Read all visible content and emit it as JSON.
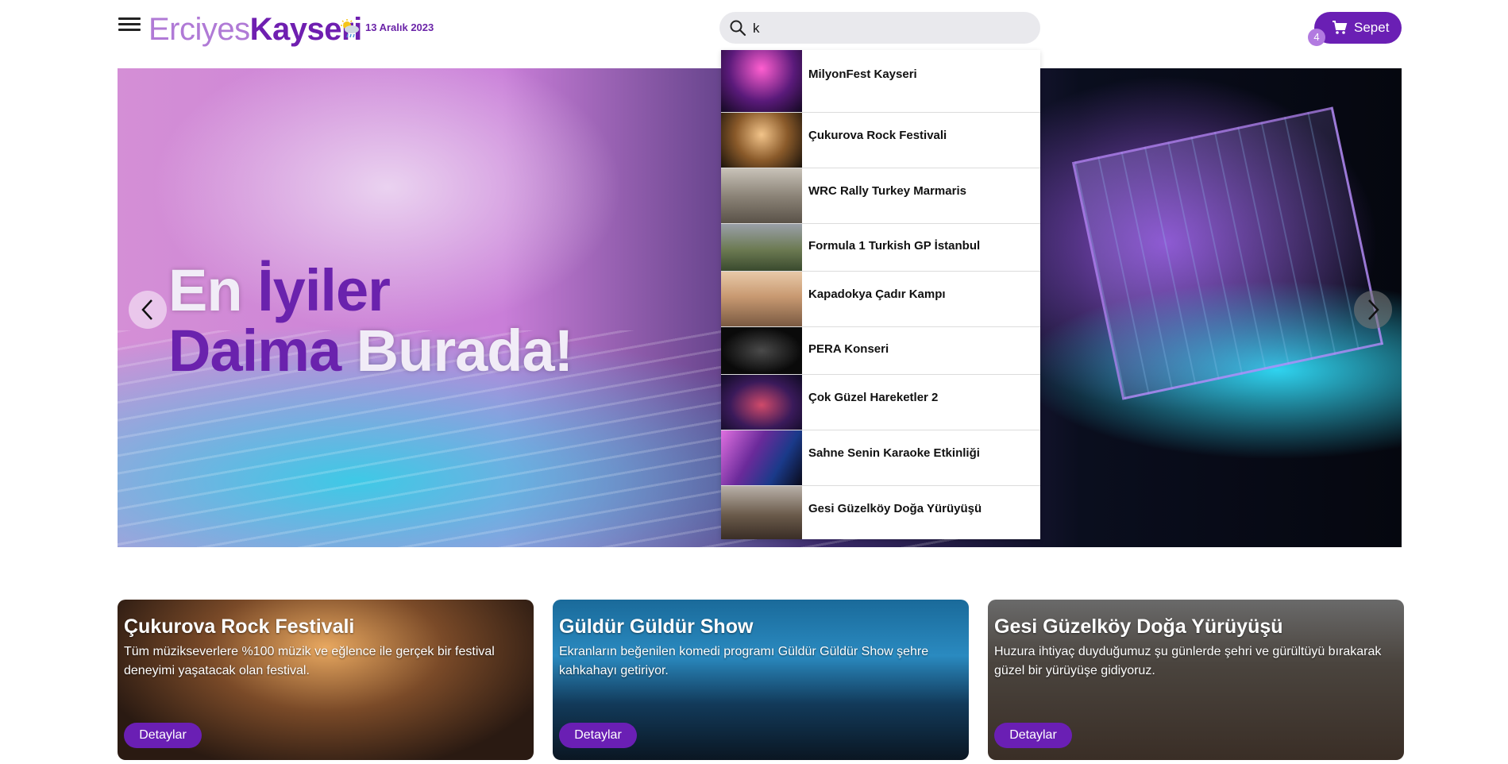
{
  "header": {
    "menu_icon": "hamburger-menu-icon",
    "logo_part1": "Erciyes",
    "logo_part2": "Kayseri",
    "weather_icon": "sun-cloud-rain-icon",
    "date": "13 Aralık 2023",
    "search": {
      "value": "k",
      "placeholder": ""
    },
    "cart": {
      "label": "Sepet",
      "count": "4"
    }
  },
  "colors": {
    "brand": "#6a1fb4",
    "brand_light": "#b07ad6"
  },
  "hero": {
    "line1_a": "En ",
    "line1_b": "İyiler",
    "line2_a": "Daima ",
    "line2_b": "Burada!"
  },
  "search_results": [
    {
      "label": "MilyonFest Kayseri"
    },
    {
      "label": "Çukurova Rock Festivali"
    },
    {
      "label": "WRC Rally Turkey Marmaris"
    },
    {
      "label": "Formula 1 Turkish GP İstanbul"
    },
    {
      "label": "Kapadokya Çadır Kampı"
    },
    {
      "label": "PERA Konseri"
    },
    {
      "label": "Çok Güzel Hareketler 2"
    },
    {
      "label": "Sahne Senin Karaoke Etkinliği"
    },
    {
      "label": "Gesi Güzelköy Doğa Yürüyüşü"
    }
  ],
  "cards": [
    {
      "title": "Çukurova Rock Festivali",
      "desc": "  Tüm müzikseverlere %100 müzik ve eğlence ile gerçek bir festival deneyimi yaşatacak olan festival.",
      "button": "Detaylar"
    },
    {
      "title": "Güldür Güldür Show",
      "desc": "  Ekranların beğenilen komedi programı Güldür Güldür Show şehre kahkahayı getiriyor.",
      "button": "Detaylar"
    },
    {
      "title": "Gesi Güzelköy Doğa Yürüyüşü",
      "desc": "  Huzura ihtiyaç duyduğumuz şu günlerde şehri ve gürültüyü bırakarak güzel bir yürüyüşe gidiyoruz.",
      "button": "Detaylar"
    }
  ]
}
